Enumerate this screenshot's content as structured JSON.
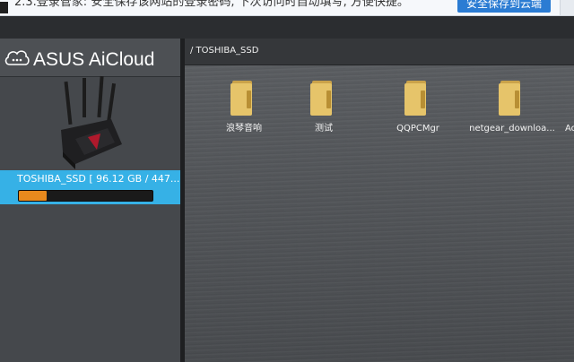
{
  "password_bar": {
    "message": "2.3.登录管家: 安全保存该网站的登录密码, 下次访问时自动填写, 方便快捷。",
    "save_button": "安全保存到云端"
  },
  "sidebar": {
    "brand": "ASUS AiCloud",
    "device": {
      "name": "TOSHIBA_SSD [ 96.12 GB / 447...",
      "usage_fraction": 0.21
    }
  },
  "main": {
    "path": "/ TOSHIBA_SSD",
    "folders": [
      {
        "label": "浪琴音响"
      },
      {
        "label": "测试"
      },
      {
        "label": "QQPCMgr"
      },
      {
        "label": "netgear_downloa..."
      },
      {
        "label": "Ac"
      }
    ]
  },
  "colors": {
    "accent": "#36b1e6",
    "usage_bar": "#e8891d",
    "folder": "#e6c46a"
  }
}
